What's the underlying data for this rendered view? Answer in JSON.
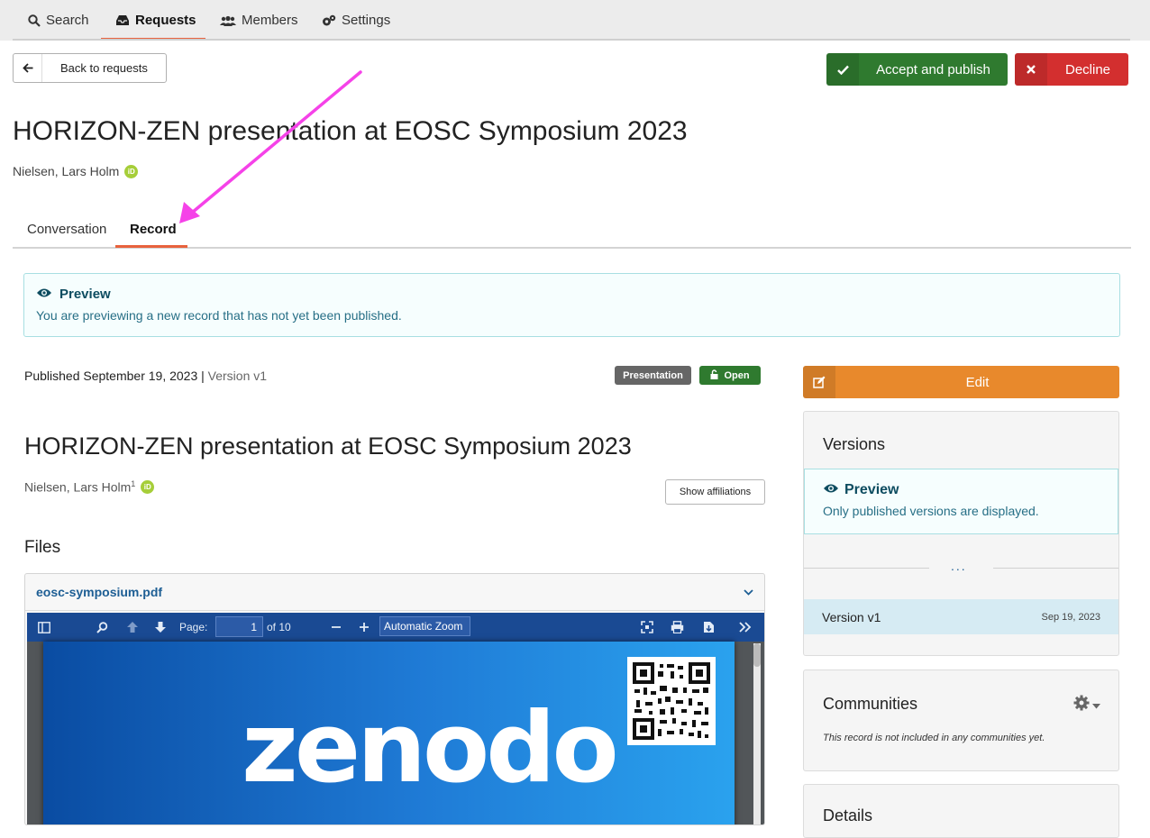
{
  "nav": {
    "search": "Search",
    "requests": "Requests",
    "members": "Members",
    "settings": "Settings"
  },
  "actions": {
    "back": "Back to requests",
    "accept": "Accept and publish",
    "decline": "Decline"
  },
  "request": {
    "title": "HORIZON-ZEN presentation at EOSC Symposium 2023",
    "author": "Nielsen, Lars Holm",
    "orcid_label": "iD"
  },
  "tabs": {
    "conversation": "Conversation",
    "record": "Record"
  },
  "preview_banner": {
    "heading": "Preview",
    "text": "You are previewing a new record that has not yet been published."
  },
  "record": {
    "published": "Published September 19, 2023",
    "separator": " | ",
    "version": "Version v1",
    "type_badge": "Presentation",
    "access_badge": "Open",
    "title": "HORIZON-ZEN presentation at EOSC Symposium 2023",
    "author": "Nielsen, Lars Holm",
    "author_sup": "1",
    "show_affiliations": "Show affiliations",
    "files_heading": "Files",
    "file_name": "eosc-symposium.pdf"
  },
  "pdf_viewer": {
    "page_label": "Page:",
    "page_value": "1",
    "page_total": "of 10",
    "zoom": "Automatic Zoom",
    "logo_text": "zenodo"
  },
  "sidebar": {
    "edit": "Edit",
    "versions": {
      "heading": "Versions",
      "preview_heading": "Preview",
      "preview_text": "Only published versions are displayed.",
      "dots": "...",
      "rows": [
        {
          "label": "Version v1",
          "date": "Sep 19, 2023"
        }
      ]
    },
    "communities": {
      "heading": "Communities",
      "note": "This record is not included in any communities yet."
    },
    "details": {
      "heading": "Details"
    }
  },
  "colors": {
    "accent": "#e8623d",
    "accept": "#2f7a2f",
    "decline": "#d32f2f",
    "edit": "#e8892c",
    "annotation_arrow": "#f542e8"
  }
}
